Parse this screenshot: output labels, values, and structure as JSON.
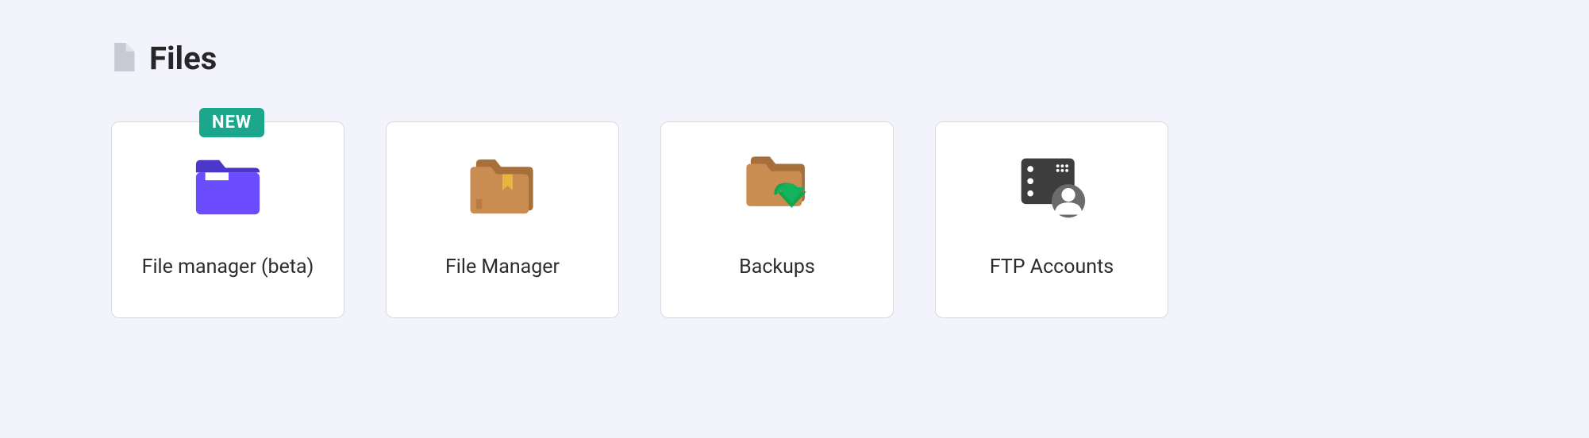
{
  "section": {
    "title": "Files"
  },
  "cards": [
    {
      "label": "File manager (beta)",
      "badge": "NEW",
      "icon": "folder-purple"
    },
    {
      "label": "File Manager",
      "badge": null,
      "icon": "folder-brown"
    },
    {
      "label": "Backups",
      "badge": null,
      "icon": "folder-backup"
    },
    {
      "label": "FTP Accounts",
      "badge": null,
      "icon": "ftp-accounts"
    }
  ],
  "colors": {
    "badge_bg": "#1aa78c",
    "page_bg": "#f3f3fb",
    "card_border": "#d9d9e3"
  }
}
